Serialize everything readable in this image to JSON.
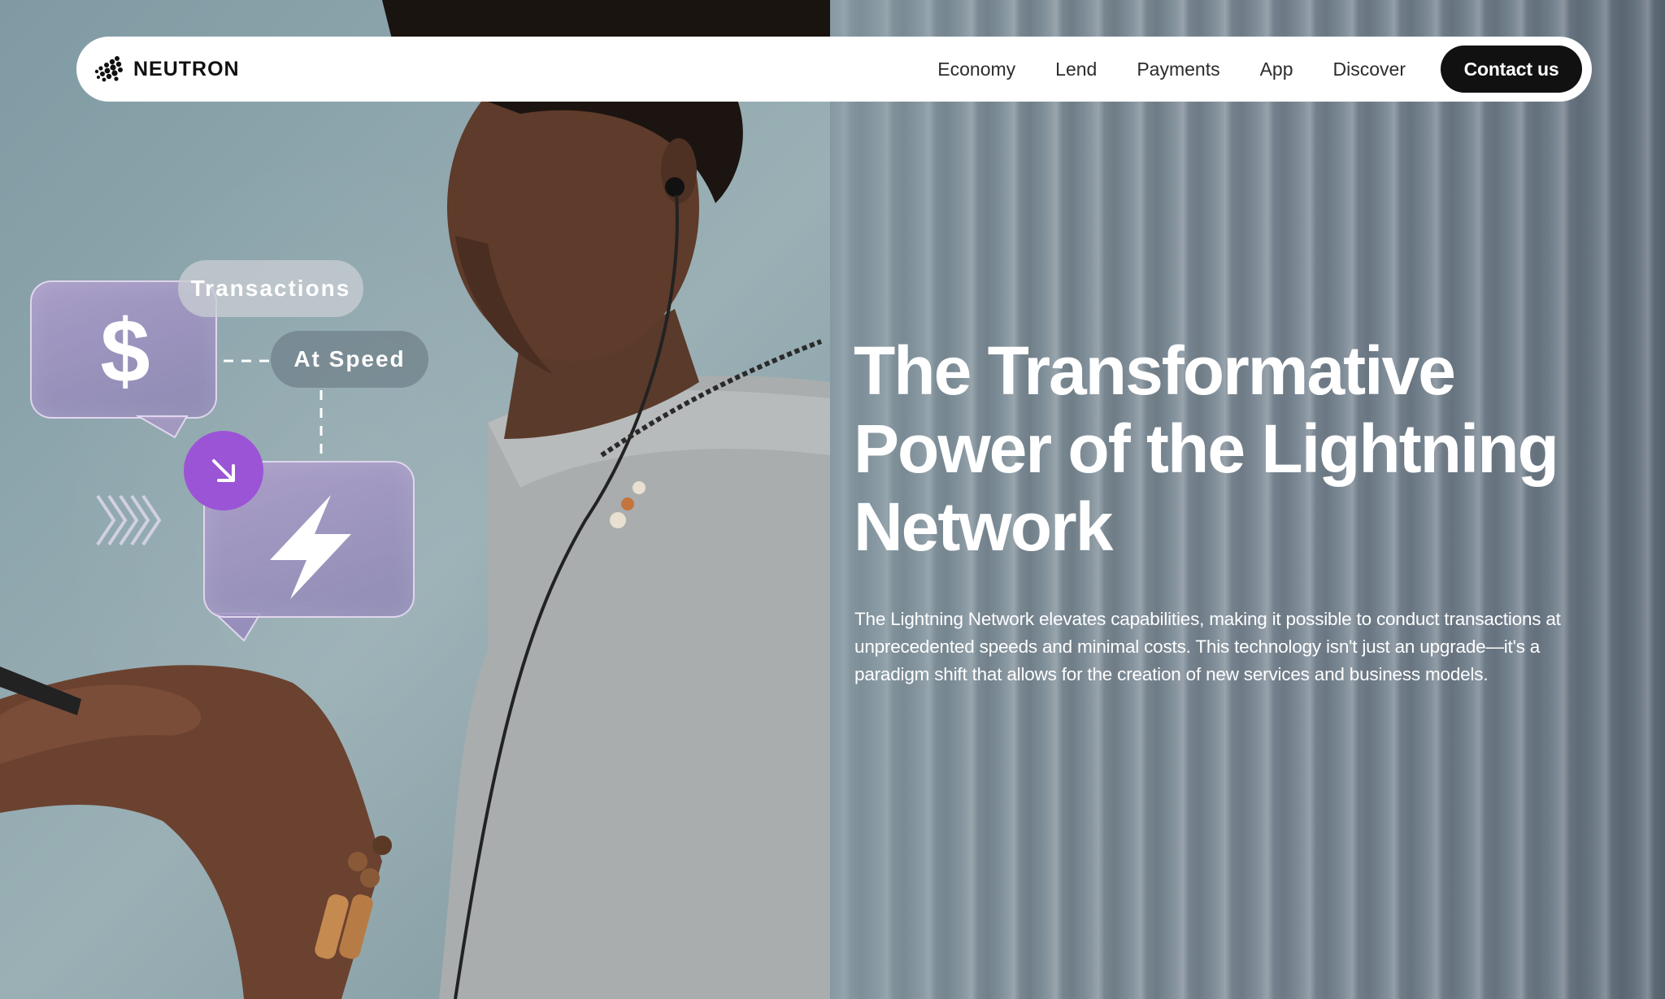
{
  "brand": {
    "name": "NEUTRON"
  },
  "nav": {
    "links": [
      "Economy",
      "Lend",
      "Payments",
      "App",
      "Discover"
    ],
    "cta": "Contact us"
  },
  "hero": {
    "title": "The Transformative Power of the Lightning Network",
    "description": "The Lightning Network elevates capabilities, making it possible to conduct transactions at unprecedented speeds and minimal costs. This technology isn't just an upgrade—it's a paradigm shift that allows for the creation of new services and business models."
  },
  "graphic": {
    "dollar_symbol": "$",
    "pill_top": "Transactions",
    "pill_bottom": "At Speed",
    "accent_color": "#9b54d6",
    "icons": [
      "dollar-icon",
      "lightning-bolt-icon",
      "arrow-down-right-icon",
      "chevrons-icon"
    ]
  }
}
